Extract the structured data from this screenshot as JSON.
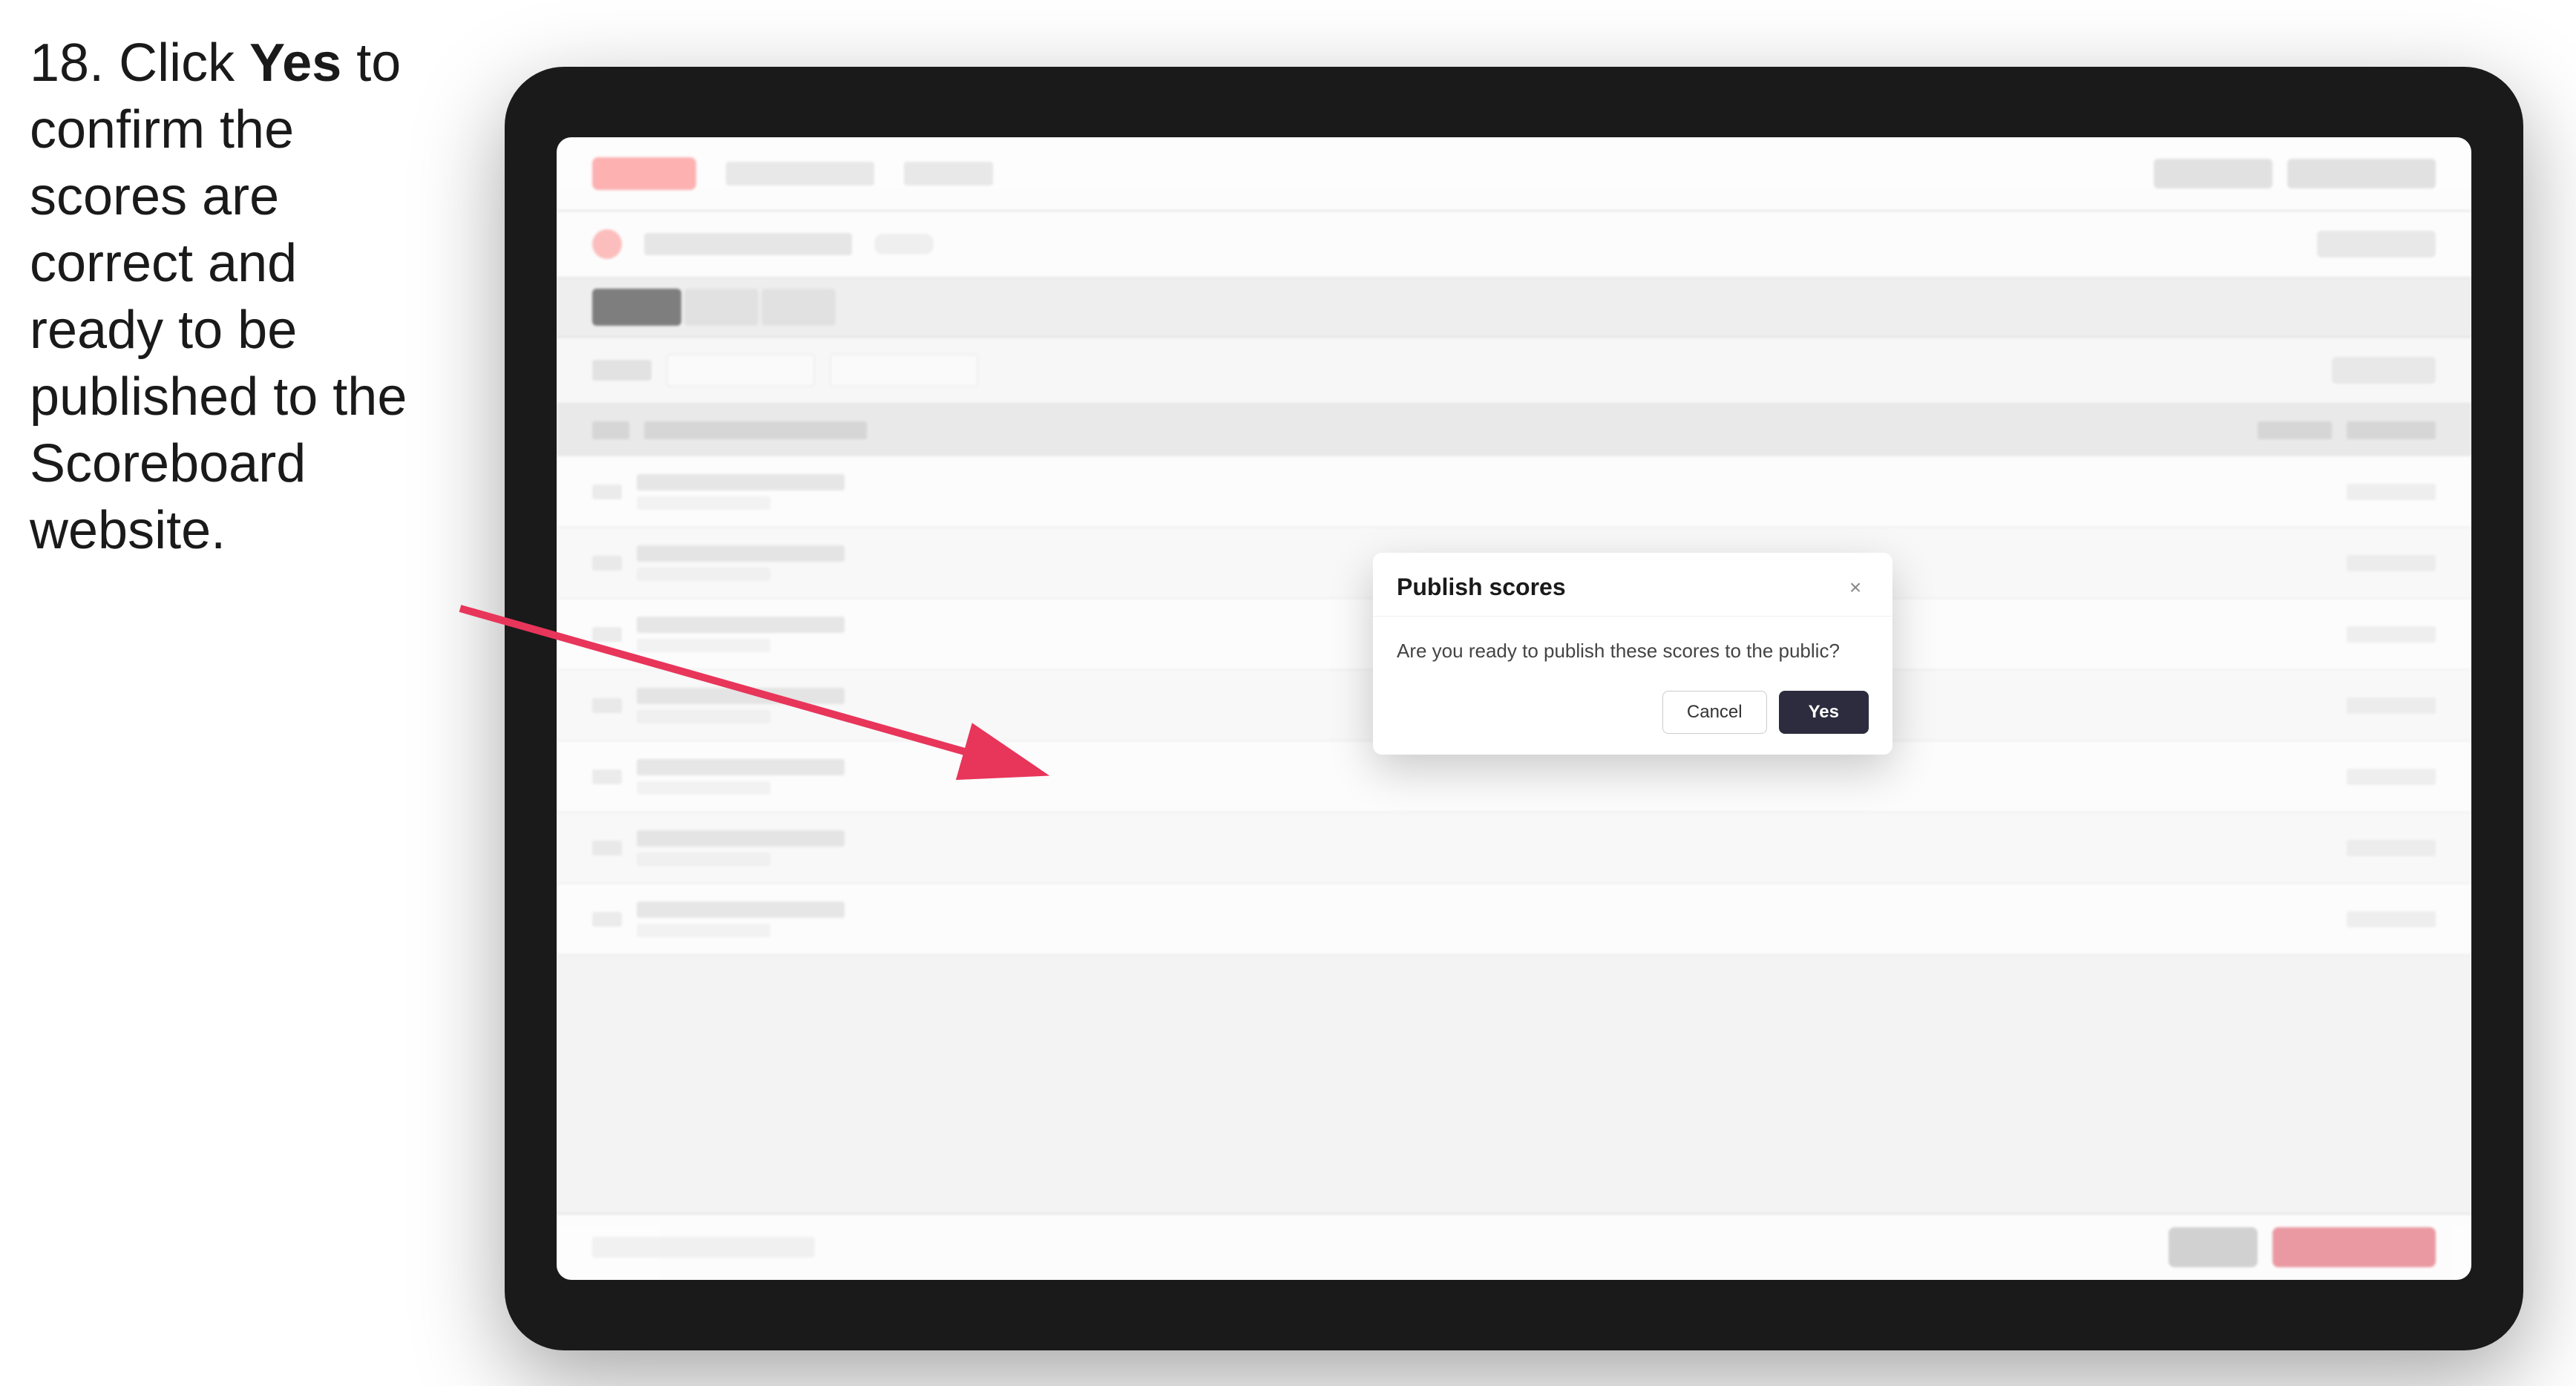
{
  "instruction": {
    "step_number": "18.",
    "text_parts": [
      "Click ",
      "Yes",
      " to confirm the scores are correct and ready to be published to the Scoreboard website."
    ]
  },
  "dialog": {
    "title": "Publish scores",
    "message": "Are you ready to publish these scores to the public?",
    "cancel_label": "Cancel",
    "confirm_label": "Yes",
    "close_label": "×"
  },
  "app": {
    "table": {
      "rows": 7
    }
  },
  "arrow": {
    "color": "#e8355a"
  }
}
